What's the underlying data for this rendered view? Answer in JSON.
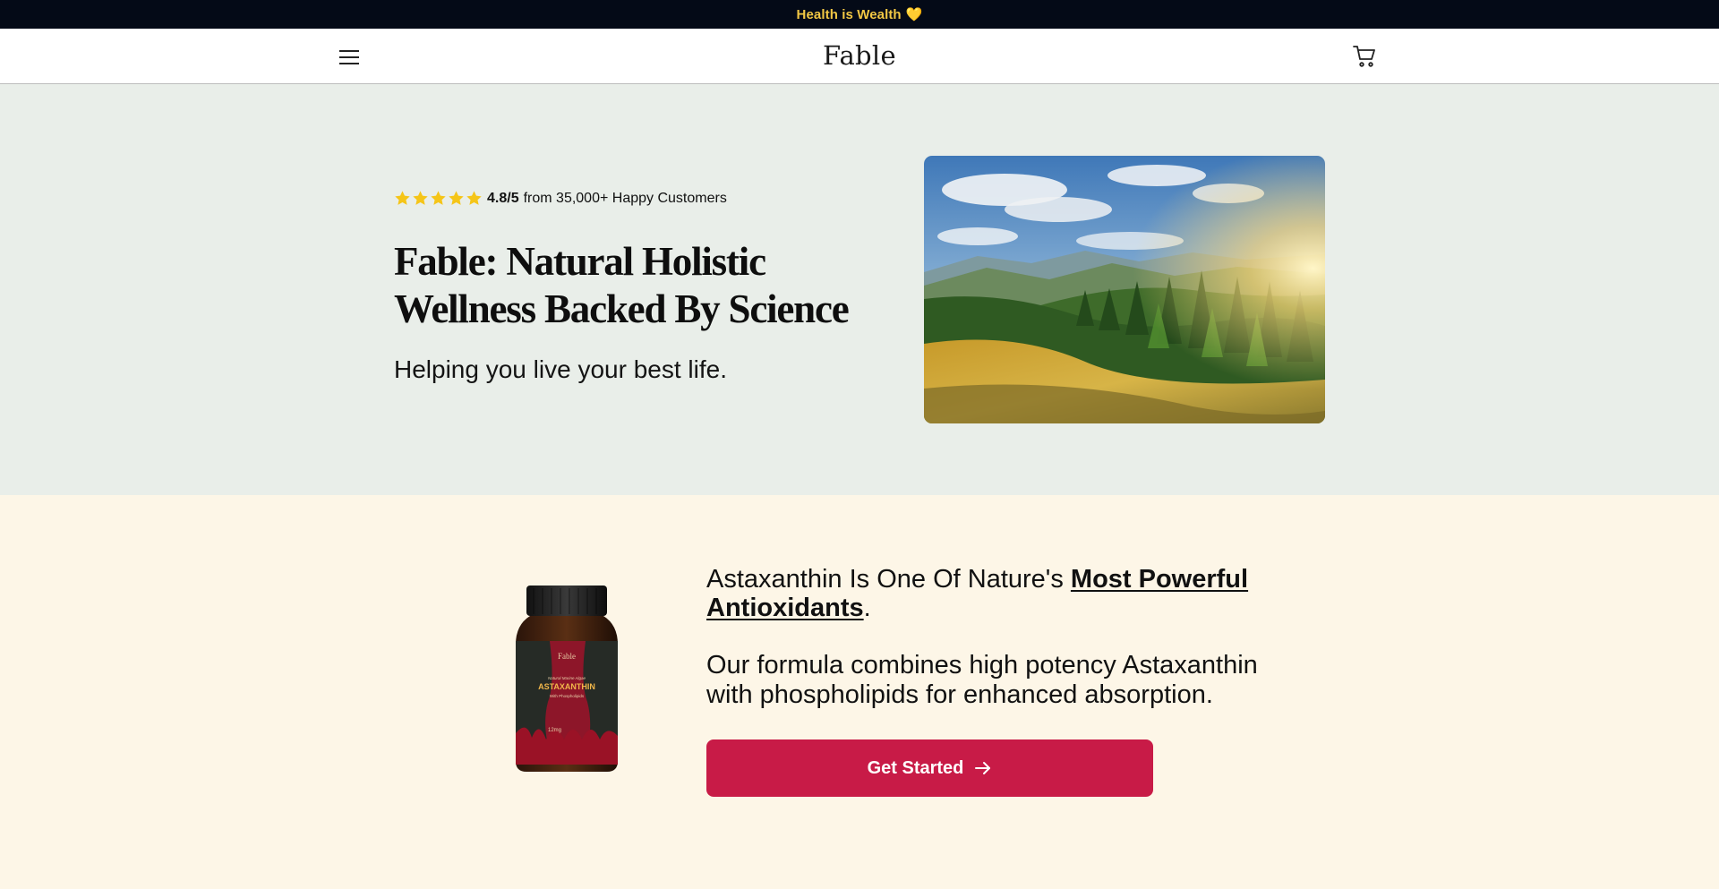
{
  "announcement": {
    "text": "Health is Wealth",
    "emoji": "💛"
  },
  "header": {
    "logo": "Fable",
    "icons": {
      "menu": "hamburger-menu-icon",
      "cart": "shopping-cart-icon"
    }
  },
  "hero": {
    "rating": {
      "stars": 5,
      "score": "4.8/5",
      "text": "from 35,000+ Happy Customers",
      "star_color": "#f5c518"
    },
    "title": "Fable: Natural Holistic Wellness Backed By Science",
    "subtitle": "Helping you live your best life.",
    "image_alt": "sunlit forest meadow landscape",
    "background": "#e9eee9"
  },
  "product": {
    "headline_prefix": "Astaxanthin Is One Of Nature's ",
    "headline_highlight": "Most Powerful Antioxidants",
    "headline_suffix": ".",
    "body": "Our formula combines high potency Astaxanthin with phospholipids for enhanced absorption.",
    "cta_label": "Get Started",
    "cta_color": "#c81b47",
    "background": "#fdf6e7",
    "bottle": {
      "brand": "Fable",
      "line1": "Natural Marine Algae",
      "name": "ASTAXANTHIN",
      "line2": "With Phospholipids",
      "dose": "12mg"
    }
  }
}
